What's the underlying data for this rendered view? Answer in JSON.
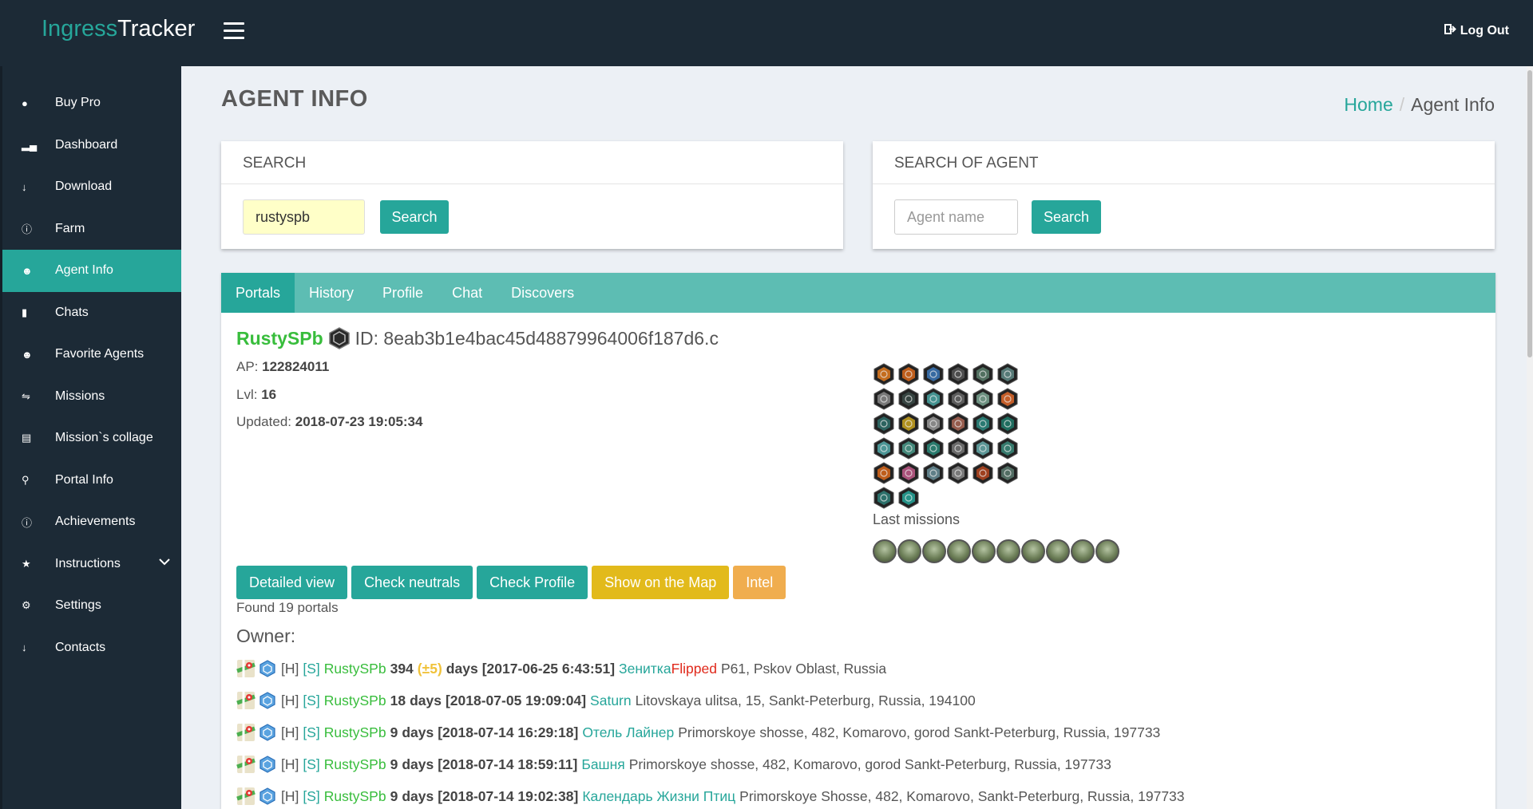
{
  "app": {
    "brand_part1": "Ingress",
    "brand_part2": "Tracker",
    "logout_label": "Log Out"
  },
  "sidebar": {
    "items": [
      {
        "label": "Buy Pro",
        "icon": "piggy-bank-icon"
      },
      {
        "label": "Dashboard",
        "icon": "bar-chart-icon"
      },
      {
        "label": "Download",
        "icon": "download-icon"
      },
      {
        "label": "Farm",
        "icon": "info-icon"
      },
      {
        "label": "Agent Info",
        "icon": "user-icon",
        "active": true
      },
      {
        "label": "Chats",
        "icon": "file-icon"
      },
      {
        "label": "Favorite Agents",
        "icon": "users-icon"
      },
      {
        "label": "Missions",
        "icon": "shuffle-icon"
      },
      {
        "label": "Mission`s collage",
        "icon": "collage-icon"
      },
      {
        "label": "Portal Info",
        "icon": "search-icon"
      },
      {
        "label": "Achievements",
        "icon": "info-icon"
      },
      {
        "label": "Instructions",
        "icon": "star-icon"
      },
      {
        "label": "Settings",
        "icon": "gear-icon"
      },
      {
        "label": "Contacts",
        "icon": "download-icon"
      }
    ]
  },
  "page": {
    "title": "AGENT INFO",
    "breadcrumb_home": "Home",
    "breadcrumb_sep": "/",
    "breadcrumb_current": "Agent Info"
  },
  "search": {
    "title": "SEARCH",
    "value": "rustyspb",
    "button": "Search"
  },
  "search_agent": {
    "title": "SEARCH OF AGENT",
    "placeholder": "Agent name",
    "button": "Search"
  },
  "tabs": [
    "Portals",
    "History",
    "Profile",
    "Chat",
    "Discovers"
  ],
  "agent": {
    "name": "RustySPb",
    "id_text": "ID: 8eab3b1e4bac45d48879964006f187d6.c",
    "ap_label": "AP:",
    "ap_value": "122824011",
    "lvl_label": "Lvl:",
    "lvl_value": "16",
    "updated_label": "Updated:",
    "updated_value": "2018-07-23 19:05:34",
    "last_missions_label": "Last missions"
  },
  "actions": {
    "detailed": "Detailed view",
    "neutrals": "Check neutrals",
    "profile": "Check Profile",
    "map": "Show on the Map",
    "intel": "Intel"
  },
  "portals": {
    "found": "Found 19 portals",
    "owner_label": "Owner:",
    "rows": [
      {
        "h": "[H]",
        "s": "[S]",
        "agent": "RustySPb",
        "days": "394",
        "plus": "(±5)",
        "days_word": "days",
        "date": "[2017-06-25 6:43:51]",
        "name": "Зенитка",
        "flipped": "Flipped",
        "address": "P61, Pskov Oblast, Russia"
      },
      {
        "h": "[H]",
        "s": "[S]",
        "agent": "RustySPb",
        "days": "18",
        "plus": "",
        "days_word": "days",
        "date": "[2018-07-05 19:09:04]",
        "name": "Saturn",
        "flipped": "",
        "address": "Litovskaya ulitsa, 15, Sankt-Peterburg, Russia, 194100"
      },
      {
        "h": "[H]",
        "s": "[S]",
        "agent": "RustySPb",
        "days": "9",
        "plus": "",
        "days_word": "days",
        "date": "[2018-07-14 16:29:18]",
        "name": "Отель Лайнер",
        "flipped": "",
        "address": "Primorskoye shosse, 482, Komarovo, gorod Sankt-Peterburg, Russia, 197733"
      },
      {
        "h": "[H]",
        "s": "[S]",
        "agent": "RustySPb",
        "days": "9",
        "plus": "",
        "days_word": "days",
        "date": "[2018-07-14 18:59:11]",
        "name": "Башня",
        "flipped": "",
        "address": "Primorskoye shosse, 482, Komarovo, gorod Sankt-Peterburg, Russia, 197733"
      },
      {
        "h": "[H]",
        "s": "[S]",
        "agent": "RustySPb",
        "days": "9",
        "plus": "",
        "days_word": "days",
        "date": "[2018-07-14 19:02:38]",
        "name": "Календарь Жизни Птиц",
        "flipped": "",
        "address": "Primorskoye Shosse, 482, Komarovo, Sankt-Peterburg, Russia, 197733"
      }
    ]
  },
  "colors": {
    "accent": "#26a69a",
    "sidebar_bg": "#1c2a36",
    "agent_green": "#38bd3c",
    "flipped_red": "#e0291b"
  }
}
